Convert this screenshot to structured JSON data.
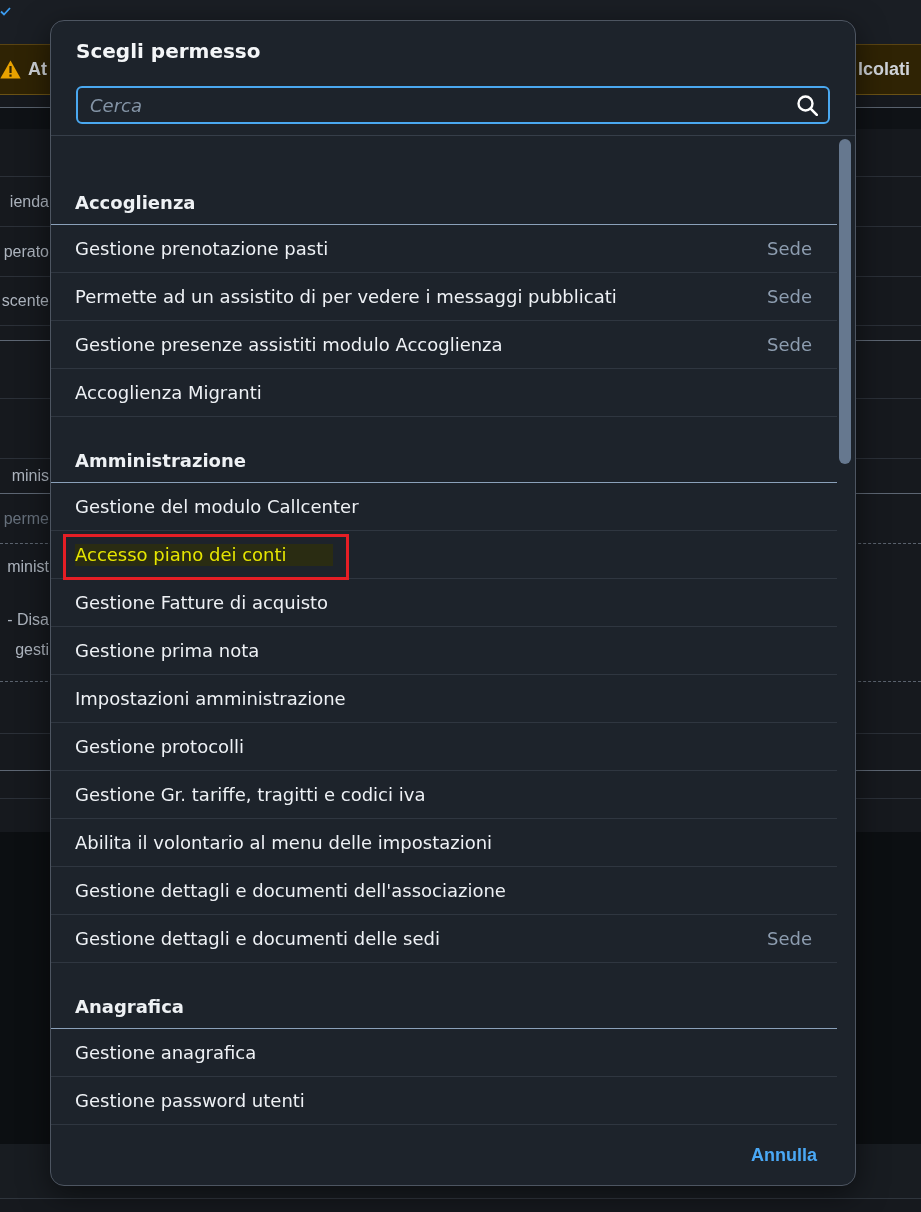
{
  "background": {
    "banner": {
      "text_left": "At",
      "text_right": "lcolati"
    },
    "rows": [
      {
        "texts": [
          "ienda"
        ],
        "muted": false
      },
      {
        "texts": [
          "perato"
        ],
        "muted": false
      },
      {
        "texts": [
          "scente"
        ],
        "muted": false
      },
      {
        "texts": [
          "minis"
        ],
        "muted": false
      },
      {
        "texts": [
          "perme"
        ],
        "muted": true
      },
      {
        "texts": [
          "minist"
        ],
        "muted": false
      },
      {
        "texts": [
          "- Disa",
          "gesti"
        ],
        "muted": false
      }
    ]
  },
  "dialog": {
    "title": "Scegli permesso",
    "search": {
      "placeholder": "Cerca"
    },
    "groups": [
      {
        "title": "Accoglienza",
        "items": [
          {
            "label": "Gestione prenotazione pasti",
            "scope": "Sede",
            "highlighted": false,
            "circled": false
          },
          {
            "label": "Permette ad un assistito di per vedere i messaggi pubblicati",
            "scope": "Sede",
            "highlighted": false,
            "circled": false
          },
          {
            "label": "Gestione presenze assistiti modulo Accoglienza",
            "scope": "Sede",
            "highlighted": false,
            "circled": false
          },
          {
            "label": "Accoglienza Migranti",
            "highlighted": false,
            "circled": false
          }
        ]
      },
      {
        "title": "Amministrazione",
        "items": [
          {
            "label": "Gestione del modulo Callcenter",
            "highlighted": false,
            "circled": false
          },
          {
            "label": "Accesso piano dei conti",
            "highlighted": true,
            "circled": true
          },
          {
            "label": "Gestione Fatture di acquisto",
            "highlighted": false,
            "circled": false
          },
          {
            "label": "Gestione prima nota",
            "highlighted": false,
            "circled": false
          },
          {
            "label": "Impostazioni amministrazione",
            "highlighted": false,
            "circled": false
          },
          {
            "label": "Gestione protocolli",
            "highlighted": false,
            "circled": false
          },
          {
            "label": "Gestione Gr. tariffe, tragitti e codici iva",
            "highlighted": false,
            "circled": false
          },
          {
            "label": "Abilita il volontario al menu delle impostazioni",
            "highlighted": false,
            "circled": false
          },
          {
            "label": "Gestione dettagli e documenti dell'associazione",
            "highlighted": false,
            "circled": false
          },
          {
            "label": "Gestione dettagli e documenti delle sedi",
            "scope": "Sede",
            "highlighted": false,
            "circled": false
          }
        ]
      },
      {
        "title": "Anagrafica",
        "items": [
          {
            "label": "Gestione anagrafica",
            "highlighted": false,
            "circled": false
          },
          {
            "label": "Gestione password utenti",
            "highlighted": false,
            "circled": false
          }
        ]
      }
    ],
    "cancel_button": "Annulla"
  }
}
